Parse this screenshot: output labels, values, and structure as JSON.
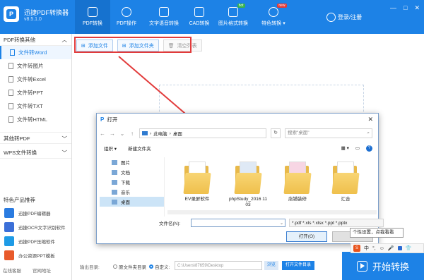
{
  "app": {
    "title": "迅捷PDF转换器",
    "version": "v8.5.1.0"
  },
  "nav": [
    {
      "label": "PDF转换",
      "badge": ""
    },
    {
      "label": "PDF操作",
      "badge": ""
    },
    {
      "label": "文字语音转换",
      "badge": ""
    },
    {
      "label": "CAD转换",
      "badge": ""
    },
    {
      "label": "图片格式转换",
      "badge": "hot"
    },
    {
      "label": "特色转换 ▾",
      "badge": "new"
    }
  ],
  "user": {
    "login": "登录/注册"
  },
  "window": {
    "min": "—",
    "max": "□",
    "close": "✕"
  },
  "sidebar": {
    "section1": "PDF转换其他",
    "items": [
      "文件转Word",
      "文件转图片",
      "文件转Excel",
      "文件转PPT",
      "文件转TXT",
      "文件转HTML"
    ],
    "section2": "其他转PDF",
    "section3": "WPS文件转换",
    "featured_title": "特色产品推荐",
    "featured": [
      "迅捷PDF编辑器",
      "迅捷OCR文字识别软件",
      "迅捷PDF压缩软件",
      "办公资源PPT模板"
    ],
    "footer": [
      "在线客服",
      "官网地址"
    ]
  },
  "toolbar": {
    "add_file": "添加文件",
    "add_folder": "添加文件夹",
    "clear_list": "清空列表"
  },
  "output": {
    "label": "输出目录:",
    "opt1": "原文件夹目录",
    "opt2": "自定义:",
    "path": "C:\\Users\\87659\\Desktop",
    "browse": "浏览",
    "open_folder": "打开文件目录"
  },
  "start_button": "开始转换",
  "dialog": {
    "title": "打开",
    "path_parts": [
      "此电脑",
      "桌面"
    ],
    "search_placeholder": "搜索\"桌面\"",
    "organize": "组织 ▾",
    "new_folder": "新建文件夹",
    "tree": [
      "图片",
      "文档",
      "下载",
      "音乐",
      "桌面"
    ],
    "files": [
      "EV录屏软件",
      "phpStudy_2016 11 03",
      "店铺装修",
      "汇合"
    ],
    "filename_label": "文件名(N):",
    "filetype": "*.pdf *.xls *.xlsx *.ppt *.pptx",
    "open_btn": "打开(O)"
  },
  "tooltip": "个性设置，点我看看",
  "ime": {
    "lang": "中"
  },
  "colors": {
    "accent": "#1d82e6",
    "highlight": "#e23b3b"
  }
}
